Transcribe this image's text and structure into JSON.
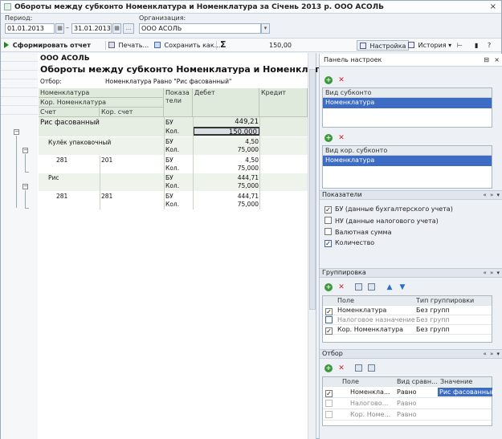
{
  "window": {
    "title": "Обороты между субконто Номенклатура и Номенклатура за Січень 2013 р. ООО АСОЛЬ",
    "close_glyph": "×"
  },
  "params": {
    "period_label": "Период:",
    "date_from": "01.01.2013",
    "date_to": "31.01.2013",
    "period_dash": "–",
    "ellipsis_btn": "...",
    "org_label": "Организация:",
    "org_value": "ООО АСОЛЬ"
  },
  "toolbar": {
    "generate": "Сформировать отчет",
    "print": "Печать...",
    "save": "Сохранить как...",
    "sum_symbol": "Σ",
    "sum_value": "150,00",
    "settings": "Настройка",
    "history": "История"
  },
  "report": {
    "org": "ООО АСОЛЬ",
    "title": "Обороты между субконто Номенклатура и Номенклатура",
    "filter_label": "Отбор:",
    "filter_value": "Номенклатура Равно \"Рис фасованный\"",
    "headers": {
      "nomenclature": "Номенклатура",
      "kor_nomenclature": "Кор. Номенклатура",
      "account": "Счет",
      "kor_account": "Кор. счет",
      "indicators": "Показа тели",
      "debit": "Дебет",
      "credit": "Кредит"
    },
    "rows": [
      {
        "name": "Рис фасованный",
        "ind1": "БУ",
        "val1": "449,21",
        "ind2": "Кол.",
        "val2": "150,000"
      },
      {
        "name": "Кулёк упаковочный",
        "ind1": "БУ",
        "val1": "4,50",
        "ind2": "Кол.",
        "val2": "75,000"
      },
      {
        "acc": "281",
        "kacc": "201",
        "ind1": "БУ",
        "val1": "4,50",
        "ind2": "Кол.",
        "val2": "75,000"
      },
      {
        "name": "Рис",
        "ind1": "БУ",
        "val1": "444,71",
        "ind2": "Кол.",
        "val2": "75,000"
      },
      {
        "acc": "281",
        "kacc": "281",
        "ind1": "БУ",
        "val1": "444,71",
        "ind2": "Кол.",
        "val2": "75,000"
      }
    ]
  },
  "panel": {
    "title": "Панель настроек",
    "subconto_header": "Вид субконто",
    "subconto_item": "Номенклатура",
    "kor_subconto_header": "Вид кор. субконто",
    "kor_subconto_item": "Номенклатура",
    "indicators_header": "Показатели",
    "indicators": [
      {
        "label": "БУ (данные бухгалтерского учета)",
        "checked": true
      },
      {
        "label": "НУ (данные налогового учета)",
        "checked": false
      },
      {
        "label": "Валютная сумма",
        "checked": false
      },
      {
        "label": "Количество",
        "checked": true
      }
    ],
    "grouping_header": "Группировка",
    "grouping_cols": {
      "field": "Поле",
      "type": "Тип группировки"
    },
    "grouping_rows": [
      {
        "field": "Номенклатура",
        "type": "Без групп",
        "checked": true,
        "disabled": false
      },
      {
        "field": "Налоговое назначение",
        "type": "Без групп",
        "checked": false,
        "disabled": true
      },
      {
        "field": "Кор. Номенклатура",
        "type": "Без групп",
        "checked": true,
        "disabled": false
      }
    ],
    "filter_header": "Отбор",
    "filter_cols": {
      "field": "Поле",
      "cmp": "Вид сравн...",
      "value": "Значение"
    },
    "filter_rows": [
      {
        "field": "Номенкла...",
        "cmp": "Равно",
        "value": "Рис фасованный",
        "checked": true,
        "disabled": false
      },
      {
        "field": "Налогово...",
        "cmp": "Равно",
        "value": "",
        "checked": false,
        "disabled": true
      },
      {
        "field": "Кор. Номе...",
        "cmp": "Равно",
        "value": "",
        "checked": false,
        "disabled": true
      }
    ],
    "arrows": "« » ▾",
    "check_glyph": "✓"
  }
}
